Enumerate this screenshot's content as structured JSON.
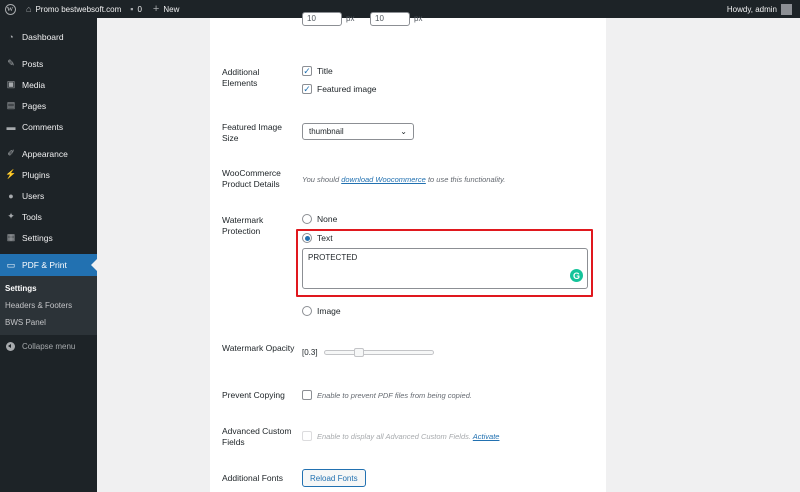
{
  "adminbar": {
    "site_name": "Promo bestwebsoft.com",
    "comments_count": "0",
    "new_label": "New",
    "howdy": "Howdy, admin"
  },
  "sidebar": {
    "items": [
      {
        "label": "Dashboard",
        "icon": "dashboard-icon"
      },
      {
        "label": "Posts",
        "icon": "pin-icon"
      },
      {
        "label": "Media",
        "icon": "media-icon"
      },
      {
        "label": "Pages",
        "icon": "page-icon"
      },
      {
        "label": "Comments",
        "icon": "comment-icon"
      },
      {
        "label": "Appearance",
        "icon": "brush-icon"
      },
      {
        "label": "Plugins",
        "icon": "plug-icon"
      },
      {
        "label": "Users",
        "icon": "user-icon"
      },
      {
        "label": "Tools",
        "icon": "wrench-icon"
      },
      {
        "label": "Settings",
        "icon": "settings-icon"
      },
      {
        "label": "PDF & Print",
        "icon": "print-icon"
      }
    ],
    "submenu": [
      "Settings",
      "Headers & Footers",
      "BWS Panel"
    ],
    "collapse": "Collapse menu"
  },
  "form": {
    "top_px_1": "10",
    "top_px_2": "10",
    "unit": "px",
    "additional_elements": {
      "label": "Additional Elements",
      "options": [
        "Title",
        "Featured image"
      ]
    },
    "featured_image_size": {
      "label": "Featured Image Size",
      "value": "thumbnail"
    },
    "woocommerce": {
      "label": "WooCommerce Product Details",
      "desc_prefix": "You should",
      "link": "download Woocommerce",
      "desc_suffix": "to use this functionality."
    },
    "watermark_protection": {
      "label": "Watermark Protection",
      "options": [
        "None",
        "Text",
        "Image"
      ],
      "selected": "Text",
      "text_value": "PROTECTED"
    },
    "watermark_opacity": {
      "label": "Watermark Opacity",
      "value": "[0.3]",
      "level": 0.3
    },
    "prevent_copying": {
      "label": "Prevent Copying",
      "desc": "Enable to prevent PDF files from being copied."
    },
    "acf": {
      "label": "Advanced Custom Fields",
      "desc": "Enable to display all Advanced Custom Fields.",
      "link": "Activate"
    },
    "additional_fonts": {
      "label": "Additional Fonts",
      "button": "Reload Fonts"
    }
  },
  "colors": {
    "admin_dark": "#1d2327",
    "accent": "#2271b1",
    "highlight": "#e0181e"
  }
}
